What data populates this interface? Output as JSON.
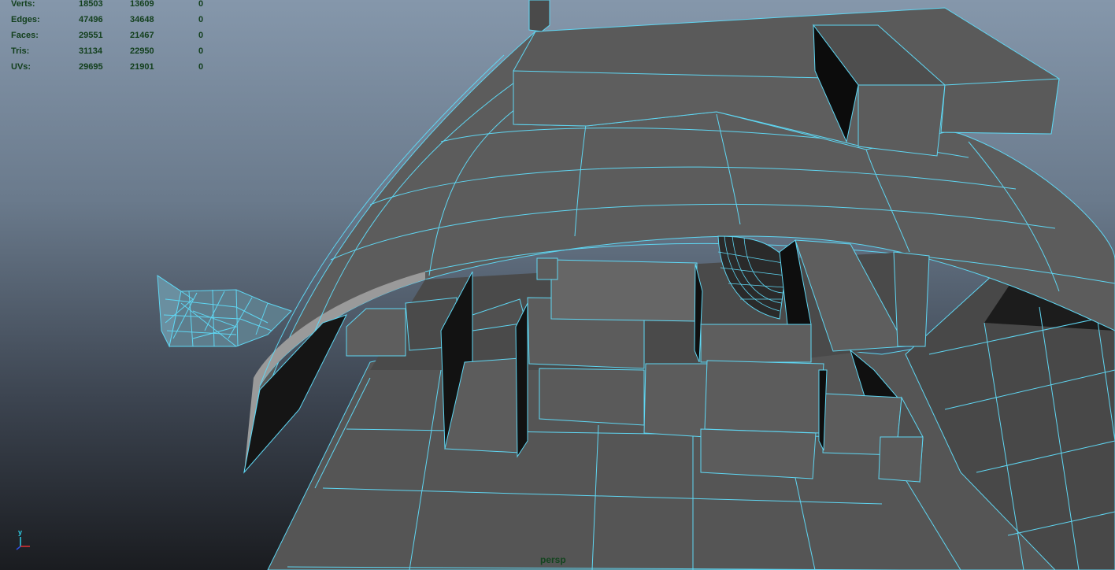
{
  "hud": {
    "rows": [
      {
        "label": "Verts:",
        "c1": "18503",
        "c2": "13609",
        "c3": "0"
      },
      {
        "label": "Edges:",
        "c1": "47496",
        "c2": "34648",
        "c3": "0"
      },
      {
        "label": "Faces:",
        "c1": "29551",
        "c2": "21467",
        "c3": "0"
      },
      {
        "label": "Tris:",
        "c1": "31134",
        "c2": "22950",
        "c3": "0"
      },
      {
        "label": "UVs:",
        "c1": "29695",
        "c2": "21901",
        "c3": "0"
      }
    ]
  },
  "camera": {
    "name": "persp"
  },
  "axis": {
    "y_label": "y"
  },
  "colors": {
    "wire": "#5fd6f2",
    "hud_text": "#123f1c",
    "face": "#5a5a5a",
    "face_dark": "#404040",
    "face_light": "#6a6a6a"
  }
}
